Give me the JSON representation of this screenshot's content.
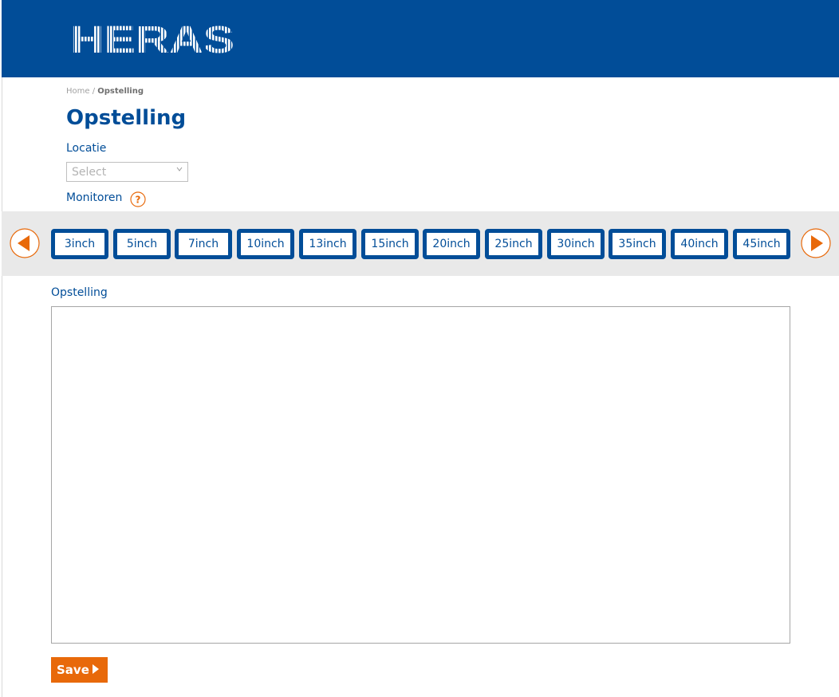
{
  "header": {
    "logo_text": "HERAS",
    "color": "#014d98"
  },
  "breadcrumb": {
    "home": "Home",
    "separator": " / ",
    "current": "Opstelling"
  },
  "page": {
    "title": "Opstelling"
  },
  "locatie": {
    "label": "Locatie",
    "placeholder": "Select"
  },
  "monitoren": {
    "label": "Monitoren",
    "help_icon": "question-icon"
  },
  "sizes": [
    "3inch",
    "5inch",
    "7inch",
    "10inch",
    "13inch",
    "15inch",
    "20inch",
    "25inch",
    "30inch",
    "35inch",
    "40inch",
    "45inch"
  ],
  "nav": {
    "prev_icon": "arrow-left-icon",
    "next_icon": "arrow-right-icon",
    "accent": "#e8690a"
  },
  "opstelling": {
    "label": "Opstelling"
  },
  "actions": {
    "save_label": "Save"
  }
}
